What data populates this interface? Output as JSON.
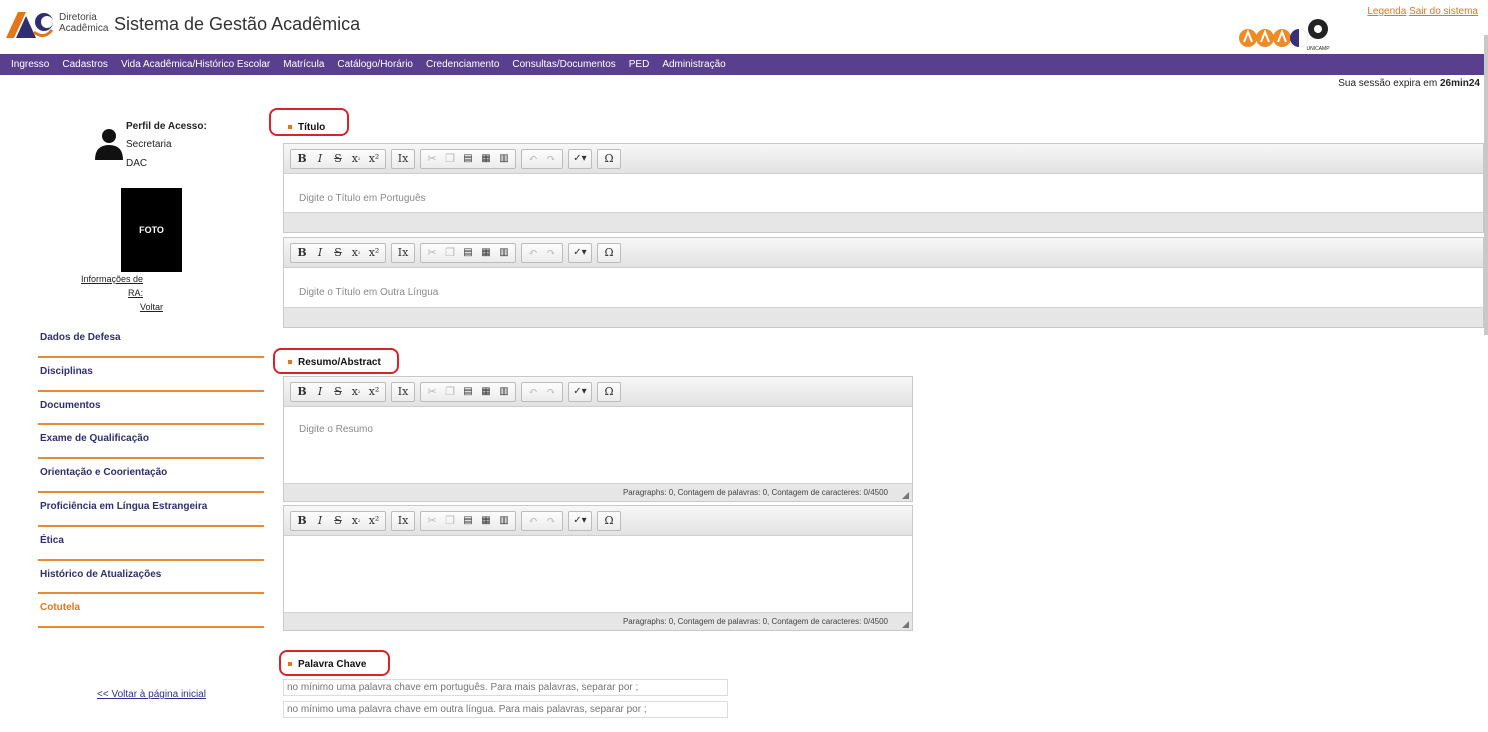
{
  "header": {
    "dir_line1": "Diretoria",
    "dir_line2": "Acadêmica",
    "title": "Sistema de Gestão Acadêmica",
    "link_legenda": "Legenda",
    "link_sair": "Sair do sistema",
    "brand_text": "UNICAMP"
  },
  "nav": [
    "Ingresso",
    "Cadastros",
    "Vida Acadêmica/Histórico Escolar",
    "Matrícula",
    "Catálogo/Horário",
    "Credenciamento",
    "Consultas/Documentos",
    "PED",
    "Administração"
  ],
  "session": {
    "prefix": "Sua sessão expira em",
    "time": "26min24"
  },
  "profile": {
    "label": "Perfil de Acesso:",
    "role": "Secretaria",
    "unit": "DAC",
    "photo": "FOTO",
    "info_link": "Informações de",
    "ra_label": "RA:",
    "back_link": "Voltar"
  },
  "side_menu": [
    "Dados de Defesa",
    "Disciplinas",
    "Documentos",
    "Exame de Qualificação",
    "Orientação e Coorientação",
    "Proficiência em Língua Estrangeira",
    "Ética",
    "Histórico de Atualizações",
    "Cotutela"
  ],
  "back_home": "<< Voltar à página inicial",
  "sections": {
    "titulo": "Título",
    "resumo": "Resumo/Abstract",
    "palavra": "Palavra Chave"
  },
  "editors": {
    "titulo_pt_placeholder": "Digite o Título em Português",
    "titulo_outra_placeholder": "Digite o Título em Outra Língua",
    "resumo_placeholder": "Digite o Resumo",
    "resumo_counter": "Paragraphs: 0, Contagem de palavras: 0, Contagem de caracteres: 0/4500",
    "abstract_counter": "Paragraphs: 0, Contagem de palavras: 0, Contagem de caracteres: 0/4500"
  },
  "keywords": {
    "pt_placeholder": "no mínimo uma palavra chave em português. Para mais palavras, separar por ;",
    "outra_placeholder": "no mínimo uma palavra chave em outra língua. Para mais palavras, separar por ;"
  },
  "colors": {
    "nav": "#5b3f8f",
    "accent": "#e2761a",
    "highlight": "#d8232a"
  }
}
